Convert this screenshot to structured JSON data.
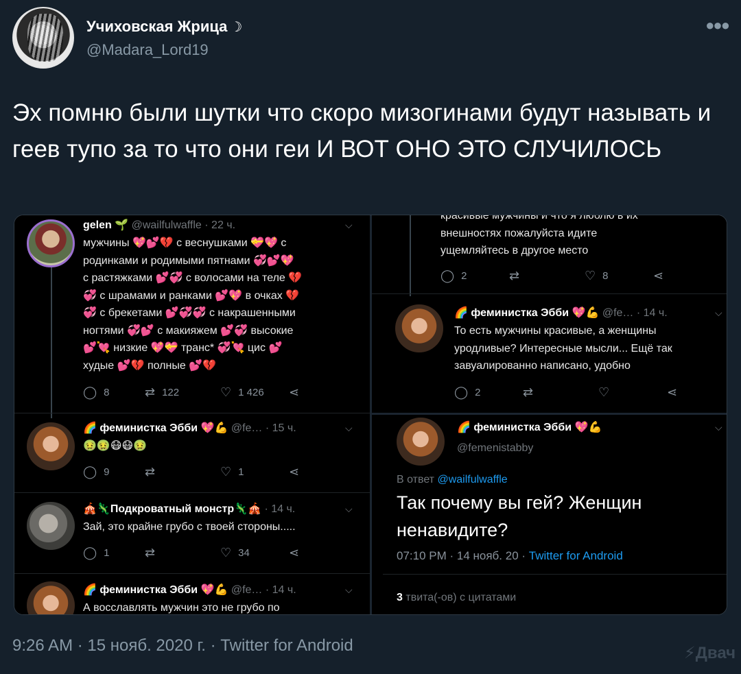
{
  "author": {
    "display_name": "Учиховская Жрица",
    "name_suffix": "☽",
    "handle": "@Madara_Lord19"
  },
  "tweet_text": "Эх помню были шутки что скоро мизогинами будут называть и геев тупо за то что они геи И ВОТ ОНО ЭТО СЛУЧИЛОСЬ",
  "screenshot_left": {
    "tweet1": {
      "name": "gelen 🌱",
      "handle_time": "@wailfulwaffle · 22 ч.",
      "lines": [
        "мужчины 💖💕💔 с веснушками 💝💖 с",
        "родинками и родимыми пятнами 💞💕💖",
        "с растяжками 💕💞 с волосами на теле 💔",
        "💞 с шрамами и ранками 💕💖 в очках 💔",
        "💞 с брекетами 💕💞💞 с накрашенными",
        "ногтями 💞💕 с макияжем 💕💞 высокие",
        "💕💘 низкие 💖💝 транс* 💞💘 цис 💕",
        "худые 💕💔 полные 💕💔"
      ],
      "replies": "8",
      "retweets": "122",
      "likes": "1 426"
    },
    "tweet2": {
      "name": "🌈 феминистка Эбби 💖💪",
      "handle_time": "@fe… · 15 ч.",
      "text": "🤢🤢😷😷🤢",
      "replies": "9",
      "retweets": "",
      "likes": "1"
    },
    "tweet3": {
      "name": "🎪🦎Подкроватный монстр🦎🎪",
      "handle_time": "· 14 ч.",
      "text": "Зай, это крайне грубо с твоей стороны.....",
      "replies": "1",
      "retweets": "",
      "likes": "34"
    },
    "tweet4": {
      "name": "🌈 феминистка Эбби 💖💪",
      "handle_time": "@fe… · 14 ч.",
      "text": "А восславлять мужчин это не грубо по"
    }
  },
  "screenshot_right_top": {
    "cut_line": "красивые мужчины и что я люблю в их",
    "line2": "внешностях пожалуйста идите",
    "line3": "ущемляйтесь в другое место",
    "replies": "2",
    "likes": "8",
    "tweet": {
      "name": "🌈 феминистка Эбби 💖💪",
      "handle_time": "@fe… · 14 ч.",
      "lines": [
        "То есть мужчины красивые, а женщины",
        "уродливые? Интересные мысли... Ещё так",
        "завуалированно написано, удобно"
      ],
      "replies": "2"
    }
  },
  "screenshot_right_bottom": {
    "name": "🌈 феминистка Эбби 💖💪",
    "handle": "@femenistabby",
    "reply_prefix": "В ответ",
    "reply_to": "@wailfulwaffle",
    "question_line1": "Так почему вы гей? Женщин",
    "question_line2": "ненавидите?",
    "meta_time": "07:10 PM · 14 нояб. 20 ·",
    "meta_source": "Twitter for Android",
    "quotes_count": "3",
    "quotes_label": "твита(-ов) с цитатами"
  },
  "footer": "9:26 AM · 15 нояб. 2020 г. · Twitter for Android",
  "watermark": "Двач",
  "icons": {
    "reply": "speech-bubble-icon",
    "retweet": "retweet-icon",
    "like": "heart-icon",
    "share": "share-icon"
  }
}
